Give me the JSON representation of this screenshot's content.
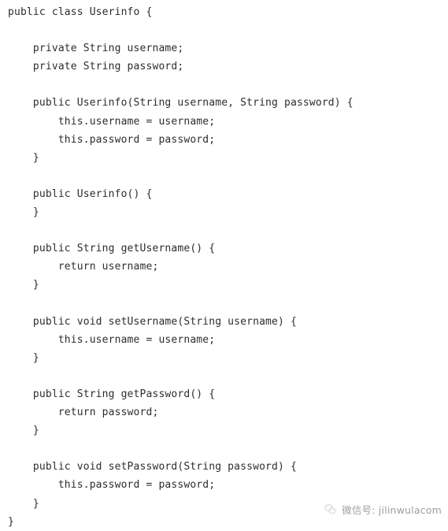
{
  "editor": {
    "language": "java",
    "background_color": "#ffffff",
    "text_color": "#2d2d2d",
    "lines": [
      "public class Userinfo {",
      "",
      "    private String username;",
      "    private String password;",
      "",
      "    public Userinfo(String username, String password) {",
      "        this.username = username;",
      "        this.password = password;",
      "    }",
      "",
      "    public Userinfo() {",
      "    }",
      "",
      "    public String getUsername() {",
      "        return username;",
      "    }",
      "",
      "    public void setUsername(String username) {",
      "        this.username = username;",
      "    }",
      "",
      "    public String getPassword() {",
      "        return password;",
      "    }",
      "",
      "    public void setPassword(String password) {",
      "        this.password = password;",
      "    }",
      "}"
    ]
  },
  "watermark": {
    "icon": "wechat-logo-icon",
    "text": "微信号: jilinwulacom",
    "color": "#9a9a9a"
  }
}
